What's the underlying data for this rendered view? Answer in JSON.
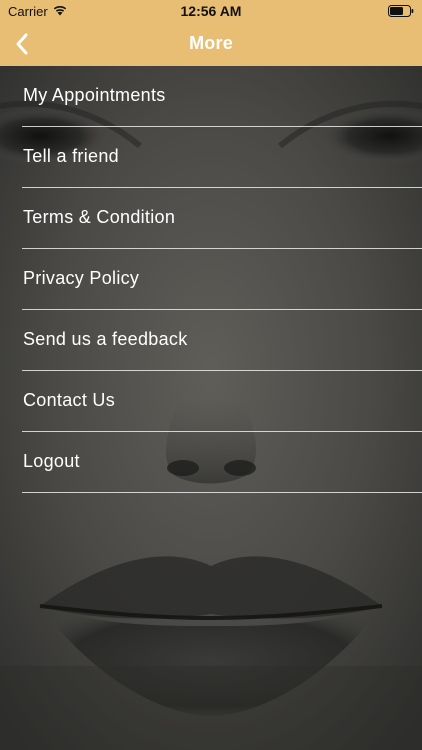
{
  "status_bar": {
    "carrier": "Carrier",
    "time": "12:56 AM"
  },
  "nav": {
    "title": "More",
    "back_icon": "chevron-left-icon"
  },
  "menu": {
    "items": [
      {
        "label": "My Appointments"
      },
      {
        "label": "Tell a friend"
      },
      {
        "label": "Terms & Condition"
      },
      {
        "label": "Privacy Policy"
      },
      {
        "label": "Send us a feedback"
      },
      {
        "label": "Contact Us"
      },
      {
        "label": "Logout"
      }
    ]
  },
  "colors": {
    "header": "#e7be73",
    "text": "#ffffff",
    "divider": "#ebebeb"
  }
}
